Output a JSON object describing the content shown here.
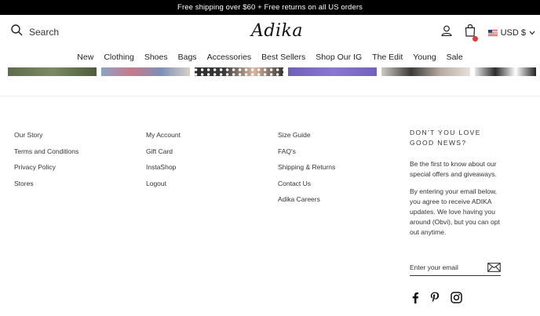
{
  "announcement": "Free shipping over $60 + Free returns on all US orders",
  "header": {
    "search_label": "Search",
    "logo": "Adika",
    "currency": "USD $",
    "icons": [
      "search-icon",
      "account-icon",
      "cart-icon",
      "flag-icon",
      "chevron-down-icon"
    ]
  },
  "nav": [
    "New",
    "Clothing",
    "Shoes",
    "Bags",
    "Accessories",
    "Best Sellers",
    "Shop Our IG",
    "The Edit",
    "Young",
    "Sale"
  ],
  "footer": {
    "col1": [
      "Our Story",
      "Terms and Conditions",
      "Privacy Policy",
      "Stores"
    ],
    "col2": [
      "My Account",
      "Gift Card",
      "InstaShop",
      "Logout"
    ],
    "col3": [
      "Size Guide",
      "FAQ's",
      "Shipping & Returns",
      "Contact Us",
      "Adika Careers"
    ],
    "newsletter": {
      "title": "DON'T YOU LOVE GOOD NEWS?",
      "text1": "Be the first to know about our special offers and giveaways.",
      "text2": "By entering your email below, you agree to receive ADIKA updates. We love having you around (Obvi), but you can opt out anytime.",
      "email_placeholder": "Enter your email"
    },
    "social": [
      "facebook-icon",
      "pinterest-icon",
      "instagram-icon"
    ]
  },
  "colors": {
    "accent_dot": "#e63a2e",
    "bar": "#000000"
  }
}
